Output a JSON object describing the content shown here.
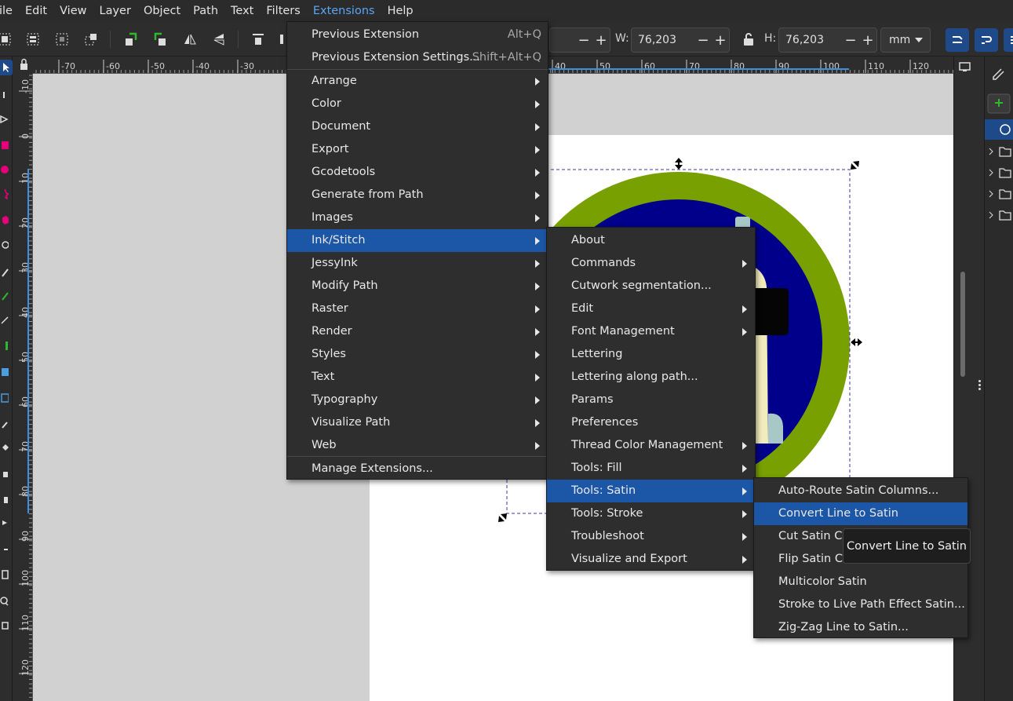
{
  "menubar": {
    "items": [
      "ile",
      "Edit",
      "View",
      "Layer",
      "Object",
      "Path",
      "Text",
      "Filters",
      "Extensions",
      "Help"
    ]
  },
  "toolbar": {
    "w_label": "W:",
    "w_value": "76,203",
    "h_label": "H:",
    "h_value": "76,203",
    "unit": "mm",
    "minus": "−",
    "plus": "+"
  },
  "ruler": {
    "h_labels": [
      "-70",
      "-60",
      "-50",
      "-40",
      "-30",
      "40",
      "50",
      "60",
      "70",
      "80",
      "90",
      "100",
      "110",
      "120"
    ],
    "v_labels": [
      "-10",
      "0",
      "10",
      "20",
      "30",
      "40",
      "50",
      "60",
      "70",
      "80",
      "90",
      "100",
      "110",
      "120"
    ]
  },
  "extensions_menu": {
    "items": [
      {
        "label": "Previous Extension",
        "accel": "Alt+Q"
      },
      {
        "label": "Previous Extension Settings...",
        "accel": "Shift+Alt+Q"
      },
      {
        "label": "Arrange"
      },
      {
        "label": "Color"
      },
      {
        "label": "Document"
      },
      {
        "label": "Export"
      },
      {
        "label": "Gcodetools"
      },
      {
        "label": "Generate from Path"
      },
      {
        "label": "Images"
      },
      {
        "label": "Ink/Stitch"
      },
      {
        "label": "JessyInk"
      },
      {
        "label": "Modify Path"
      },
      {
        "label": "Raster"
      },
      {
        "label": "Render"
      },
      {
        "label": "Styles"
      },
      {
        "label": "Text"
      },
      {
        "label": "Typography"
      },
      {
        "label": "Visualize Path"
      },
      {
        "label": "Web"
      },
      {
        "label": "Manage Extensions..."
      }
    ]
  },
  "inkstitch_menu": {
    "items": [
      {
        "label": "About"
      },
      {
        "label": "Commands"
      },
      {
        "label": "Cutwork segmentation..."
      },
      {
        "label": "Edit"
      },
      {
        "label": "Font Management"
      },
      {
        "label": "Lettering"
      },
      {
        "label": "Lettering along path..."
      },
      {
        "label": "Params"
      },
      {
        "label": "Preferences"
      },
      {
        "label": "Thread Color Management"
      },
      {
        "label": "Tools: Fill"
      },
      {
        "label": "Tools: Satin"
      },
      {
        "label": "Tools: Stroke"
      },
      {
        "label": "Troubleshoot"
      },
      {
        "label": "Visualize and Export"
      }
    ]
  },
  "satin_menu": {
    "items": [
      {
        "label": "Auto-Route Satin Columns..."
      },
      {
        "label": "Convert Line to Satin"
      },
      {
        "label": "Cut Satin Column"
      },
      {
        "label": "Flip Satin Column Rails"
      },
      {
        "label": "Multicolor Satin"
      },
      {
        "label": "Stroke to Live Path Effect Satin..."
      },
      {
        "label": "Zig-Zag Line to Satin..."
      }
    ]
  },
  "tooltip": {
    "text": "Convert Line to Satin"
  },
  "colors": {
    "ring": "#78a000",
    "inner": "#00008b",
    "figure": "#f5f0c0",
    "highlight": "#1c56a6"
  }
}
